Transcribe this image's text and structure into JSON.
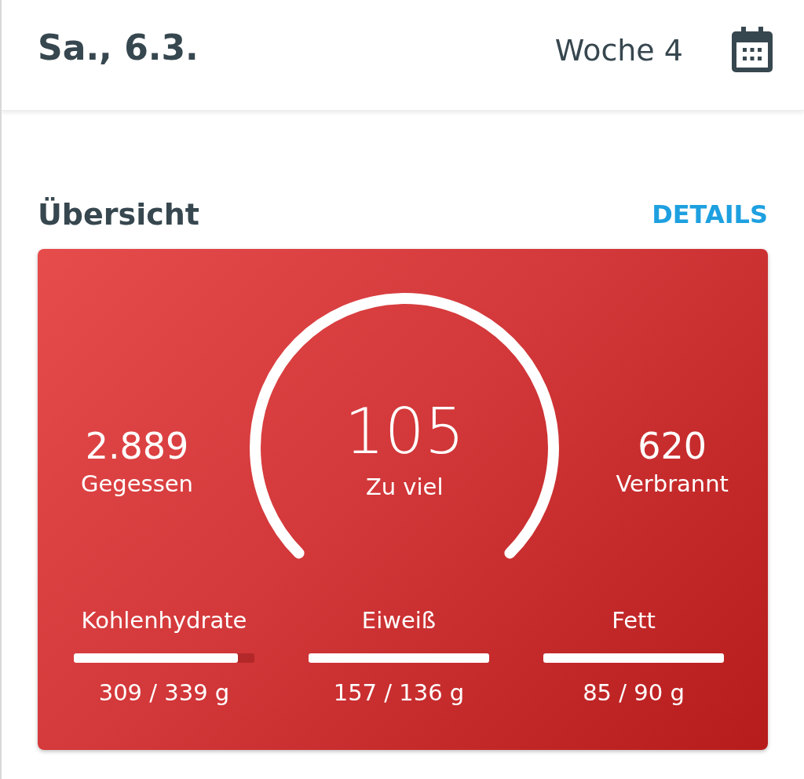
{
  "header": {
    "date": "Sa., 6.3.",
    "week": "Woche 4"
  },
  "overview": {
    "title": "Übersicht",
    "details_link": "DETAILS"
  },
  "summary": {
    "eaten": {
      "value": "2.889",
      "label": "Gegessen"
    },
    "remaining": {
      "value": "105",
      "label": "Zu viel"
    },
    "burned": {
      "value": "620",
      "label": "Verbrannt"
    }
  },
  "macros": [
    {
      "name": "Kohlenhydrate",
      "level": 0.91,
      "reading": "309 / 339 g"
    },
    {
      "name": "Eiweiß",
      "level": 1,
      "reading": "157 / 136 g"
    },
    {
      "name": "Fett",
      "level": 1,
      "reading": "85 / 90 g"
    }
  ]
}
